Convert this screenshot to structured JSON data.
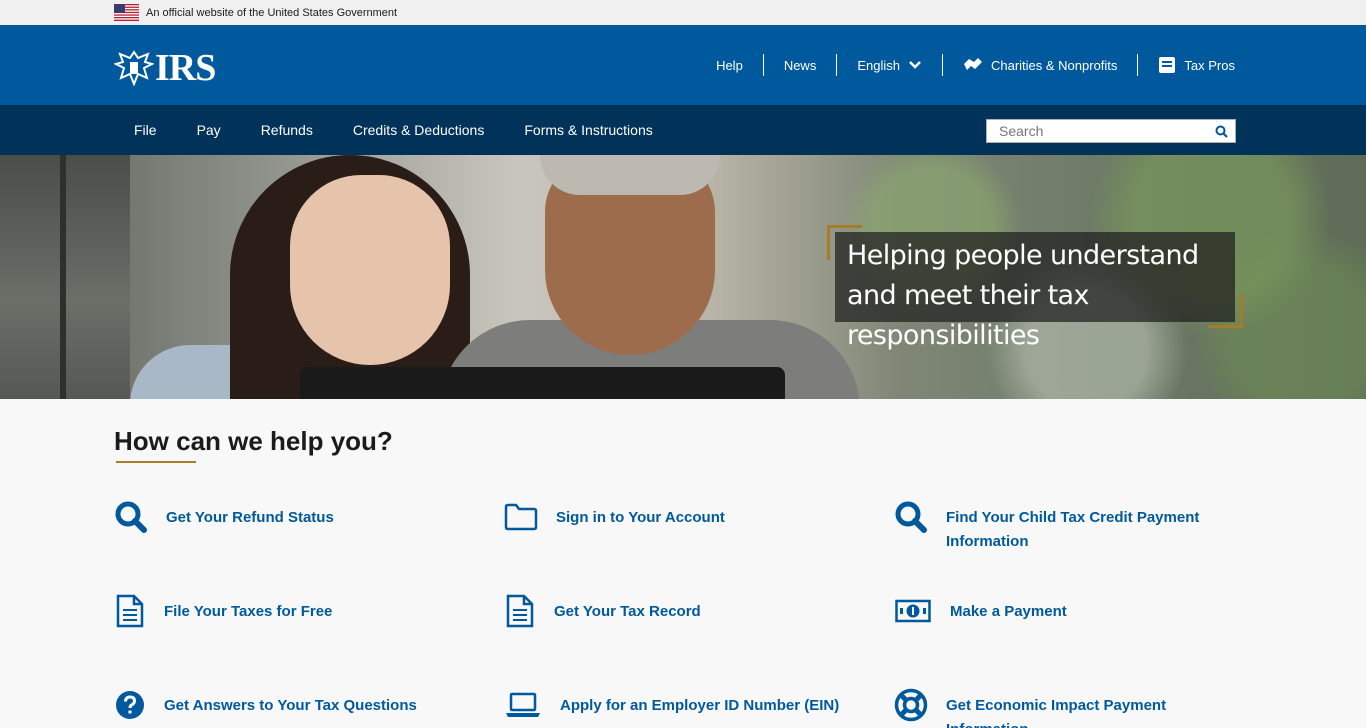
{
  "gov_banner": {
    "text": "An official website of the United States Government"
  },
  "header": {
    "logo_text": "IRS",
    "util_nav": {
      "help": "Help",
      "news": "News",
      "language": "English",
      "charities": "Charities & Nonprofits",
      "tax_pros": "Tax Pros"
    }
  },
  "main_nav": {
    "items": [
      "File",
      "Pay",
      "Refunds",
      "Credits & Deductions",
      "Forms & Instructions"
    ],
    "search_placeholder": "Search"
  },
  "hero": {
    "caption": "Helping people understand and meet their tax responsibilities"
  },
  "help": {
    "title": "How can we help you?",
    "tiles": [
      {
        "label": "Get Your Refund Status",
        "icon": "search-icon"
      },
      {
        "label": "Sign in to Your Account",
        "icon": "folder-icon"
      },
      {
        "label": "Find Your Child Tax Credit Payment Information",
        "icon": "search-icon"
      },
      {
        "label": "File Your Taxes for Free",
        "icon": "document-icon"
      },
      {
        "label": "Get Your Tax Record",
        "icon": "document-icon"
      },
      {
        "label": "Make a Payment",
        "icon": "money-icon"
      },
      {
        "label": "Get Answers to Your Tax Questions",
        "icon": "question-icon"
      },
      {
        "label": "Apply for an Employer ID Number (EIN)",
        "icon": "laptop-icon"
      },
      {
        "label": "Get Economic Impact Payment Information",
        "icon": "lifebuoy-icon"
      }
    ]
  },
  "colors": {
    "brand_blue": "#00599c",
    "nav_dark": "#00325a",
    "accent_gold": "#a57c2a"
  }
}
